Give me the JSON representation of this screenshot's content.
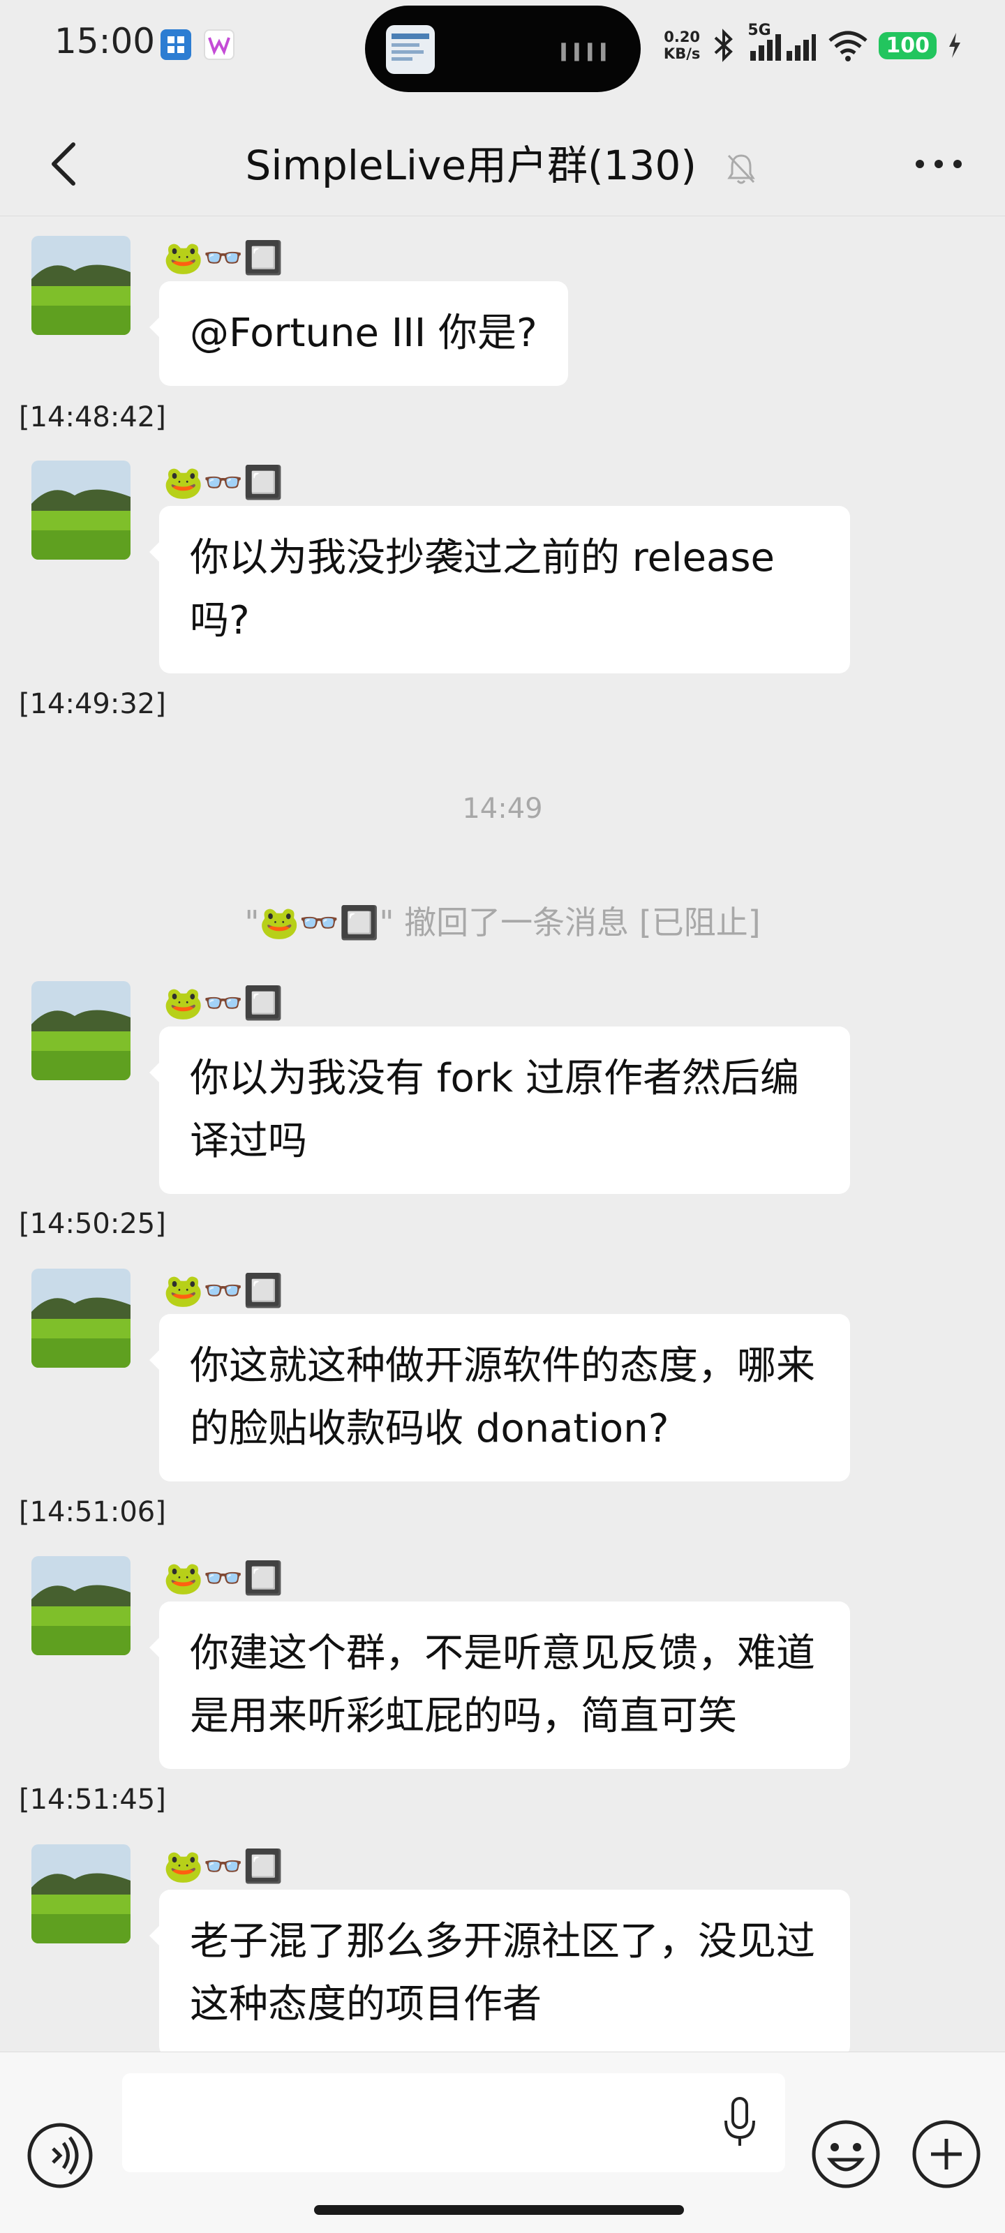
{
  "status_bar": {
    "time": "15:00",
    "net_speed_value": "0.20",
    "net_speed_unit": "KB/s",
    "network": "5G",
    "battery": "100",
    "icons": [
      "app-icon-blue",
      "app-icon-w",
      "bluetooth-icon",
      "signal-icon",
      "wifi-icon",
      "charging-icon"
    ]
  },
  "header": {
    "title": "SimpleLive用户群(130)",
    "icons": [
      "back-icon",
      "mute-icon",
      "more-icon"
    ]
  },
  "messages": [
    {
      "sender": "🐸👓🔲",
      "text": "@Fortune III  你是?",
      "timestamp": "[14:48:42]"
    },
    {
      "sender": "🐸👓🔲",
      "text": "你以为我没抄袭过之前的 release 吗?",
      "timestamp": "[14:49:32]"
    },
    {
      "sender": "🐸👓🔲",
      "text": "你以为我没有 fork 过原作者然后编译过吗",
      "timestamp": "[14:50:25]"
    },
    {
      "sender": "🐸👓🔲",
      "text": "你这就这种做开源软件的态度，哪来的脸贴收款码收 donation?",
      "timestamp": "[14:51:06]"
    },
    {
      "sender": "🐸👓🔲",
      "text": "你建这个群，不是听意见反馈，难道是用来听彩虹屁的吗，简直可笑",
      "timestamp": "[14:51:45]"
    },
    {
      "sender": "🐸👓🔲",
      "text": "老子混了那么多开源社区了，没见过这种态度的项目作者",
      "timestamp": ""
    }
  ],
  "center_time": "14:49",
  "system_message": "\"🐸👓🔲\" 撤回了一条消息 [已阻止]",
  "input_bar": {
    "placeholder": "",
    "icons": [
      "voice-icon",
      "mic-icon",
      "emoji-icon",
      "plus-icon"
    ]
  }
}
